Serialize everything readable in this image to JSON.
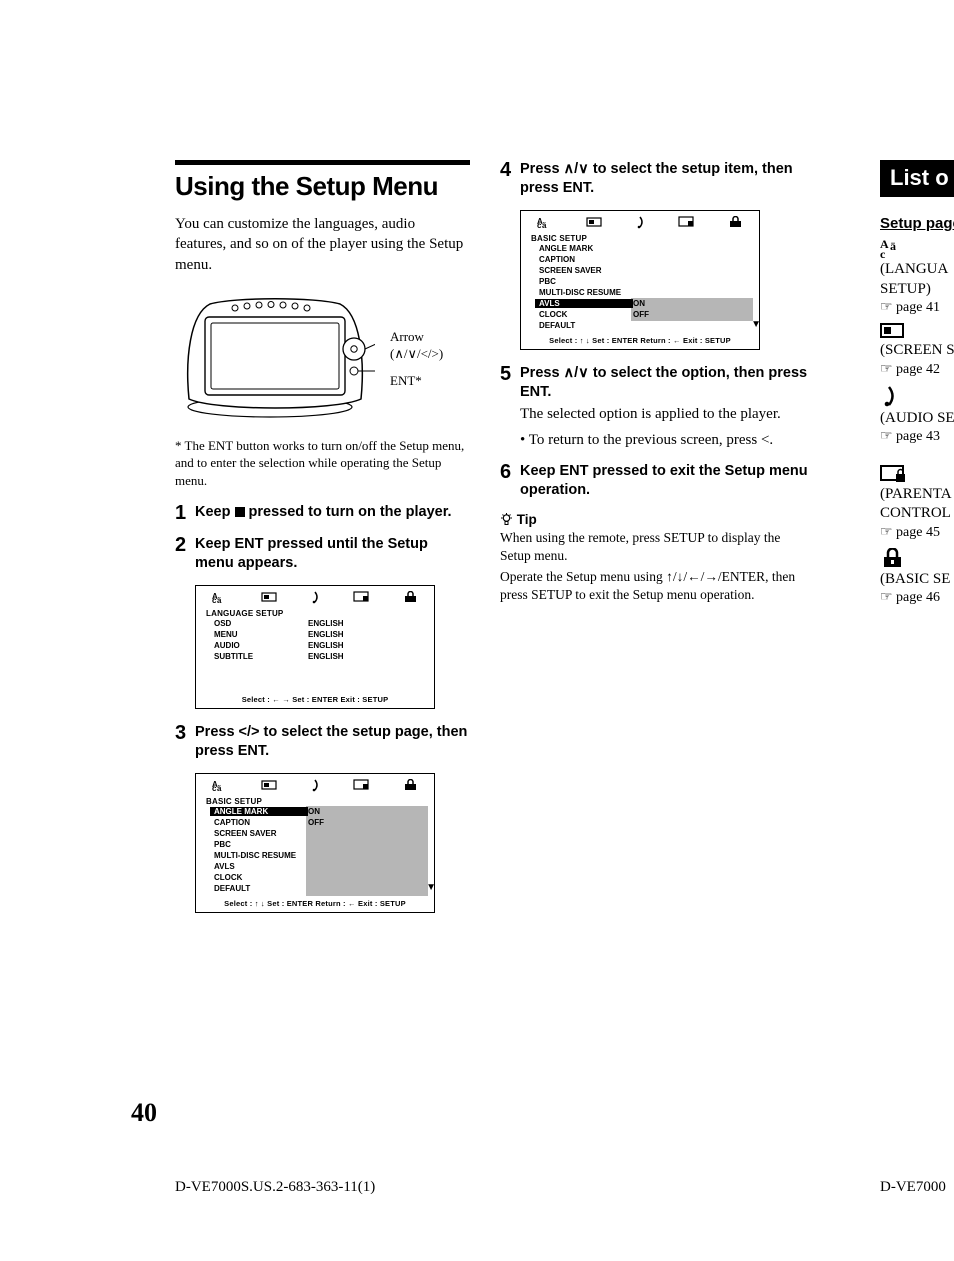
{
  "page_number": "40",
  "footer_left": "D-VE7000S.US.2-683-363-11(1)",
  "footer_right": "D-VE7000",
  "col1": {
    "heading": "Using the Setup Menu",
    "intro": "You can customize the languages, audio features, and so on of the player using the Setup menu.",
    "callout_arrow": "Arrow",
    "callout_arrow_sub": "(∧/∨/</>)",
    "callout_ent": "ENT*",
    "footnote": "* The ENT button works to turn on/off the Setup menu, and to enter the selection while operating the Setup menu.",
    "step1_num": "1",
    "step1": "Keep ■ pressed to turn on the player.",
    "step2_num": "2",
    "step2": "Keep ENT pressed until the Setup menu appears.",
    "osd_lang": {
      "title": "LANGUAGE SETUP",
      "rows": [
        {
          "label": "OSD",
          "value": "ENGLISH"
        },
        {
          "label": "MENU",
          "value": "ENGLISH"
        },
        {
          "label": "AUDIO",
          "value": "ENGLISH"
        },
        {
          "label": "SUBTITLE",
          "value": "ENGLISH"
        }
      ],
      "footer": "Select : ←  →   Set : ENTER  Exit : SETUP"
    },
    "step3_num": "3",
    "step3": "Press </> to select the setup page, then press ENT.",
    "osd_basic": {
      "title": "BASIC SETUP",
      "rows": [
        {
          "label": "ANGLE MARK",
          "value": "ON",
          "hl": true
        },
        {
          "label": "CAPTION",
          "value": "OFF"
        },
        {
          "label": "SCREEN SAVER",
          "value": ""
        },
        {
          "label": "PBC",
          "value": ""
        },
        {
          "label": "MULTI-DISC RESUME",
          "value": ""
        },
        {
          "label": "AVLS",
          "value": ""
        },
        {
          "label": "CLOCK",
          "value": ""
        },
        {
          "label": "DEFAULT",
          "value": ""
        }
      ],
      "footer": "Select : ↑  ↓   Set : ENTER  Return : ←  Exit : SETUP"
    }
  },
  "col2": {
    "step4_num": "4",
    "step4": "Press ∧/∨ to select the setup item, then press ENT.",
    "osd_basic2": {
      "title": "BASIC SETUP",
      "rows": [
        {
          "label": "ANGLE MARK",
          "value": ""
        },
        {
          "label": "CAPTION",
          "value": ""
        },
        {
          "label": "SCREEN SAVER",
          "value": ""
        },
        {
          "label": "PBC",
          "value": ""
        },
        {
          "label": "MULTI-DISC RESUME",
          "value": ""
        },
        {
          "label": "AVLS",
          "value": "ON",
          "hl": true
        },
        {
          "label": "CLOCK",
          "value": "OFF"
        },
        {
          "label": "DEFAULT",
          "value": ""
        }
      ],
      "footer": "Select : ↑  ↓   Set : ENTER  Return : ←  Exit : SETUP"
    },
    "step5_num": "5",
    "step5": "Press ∧/∨ to select the option, then press ENT.",
    "step5_text": "The selected option is applied to the player.",
    "step5_bullet": "• To return to the previous screen, press <.",
    "step6_num": "6",
    "step6": "Keep ENT pressed to exit the Setup menu operation.",
    "tip_title": "Tip",
    "tip_body1": "When using the remote, press SETUP to display the Setup menu.",
    "tip_body2": "Operate the Setup menu using ↑/↓/←/→/ENTER, then press SETUP to exit the Setup menu operation."
  },
  "col3": {
    "list_heading": "List o",
    "setup_page_label": "Setup page",
    "items": [
      {
        "label": "(LANGUA",
        "label2": "SETUP)",
        "page": "☞ page 41"
      },
      {
        "label": "(SCREEN S",
        "label2": "",
        "page": "☞ page 42"
      },
      {
        "label": "(AUDIO SE",
        "label2": "",
        "page": "☞ page 43"
      },
      {
        "label": "(PARENTA",
        "label2": "CONTROL",
        "page": "☞ page 45"
      },
      {
        "label": "(BASIC SE",
        "label2": "",
        "page": "☞ page 46"
      }
    ]
  }
}
